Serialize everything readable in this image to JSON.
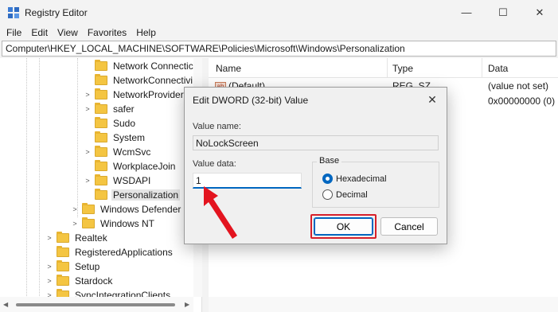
{
  "window": {
    "title": "Registry Editor",
    "minimize_glyph": "—",
    "maximize_glyph": "☐",
    "close_glyph": "✕"
  },
  "menu": [
    "File",
    "Edit",
    "View",
    "Favorites",
    "Help"
  ],
  "address": "Computer\\HKEY_LOCAL_MACHINE\\SOFTWARE\\Policies\\Microsoft\\Windows\\Personalization",
  "tree": [
    {
      "label": "Network Connectic",
      "chevron": ""
    },
    {
      "label": "NetworkConnectivi",
      "chevron": ""
    },
    {
      "label": "NetworkProvider",
      "chevron": ">"
    },
    {
      "label": "safer",
      "chevron": ">"
    },
    {
      "label": "Sudo",
      "chevron": ""
    },
    {
      "label": "System",
      "chevron": ""
    },
    {
      "label": "WcmSvc",
      "chevron": ">"
    },
    {
      "label": "WorkplaceJoin",
      "chevron": ""
    },
    {
      "label": "WSDAPI",
      "chevron": ">"
    },
    {
      "label": "Personalization",
      "chevron": ""
    },
    {
      "label": "Windows Defender",
      "chevron": ">"
    },
    {
      "label": "Windows NT",
      "chevron": ">"
    },
    {
      "label": "Realtek",
      "chevron": ">"
    },
    {
      "label": "RegisteredApplications",
      "chevron": ""
    },
    {
      "label": "Setup",
      "chevron": ">"
    },
    {
      "label": "Stardock",
      "chevron": ">"
    },
    {
      "label": "SyncIntegrationClients",
      "chevron": ">"
    }
  ],
  "list": {
    "columns": [
      "Name",
      "Type",
      "Data"
    ],
    "rows": [
      {
        "icon": "ab",
        "name": "(Default)",
        "type": "REG_SZ",
        "data": "(value not set)"
      },
      {
        "icon": "",
        "name": "",
        "type": "",
        "data": "0x00000000 (0)"
      }
    ]
  },
  "dialog": {
    "title": "Edit DWORD (32-bit) Value",
    "close_glyph": "✕",
    "value_name_label": "Value name:",
    "value_name": "NoLockScreen",
    "value_data_label": "Value data:",
    "value_data": "1",
    "base_label": "Base",
    "base_options": [
      "Hexadecimal",
      "Decimal"
    ],
    "base_selected": "Hexadecimal",
    "ok_label": "OK",
    "cancel_label": "Cancel"
  },
  "colors": {
    "accent": "#0067c0",
    "highlight": "#d6202a",
    "folder": "#f4c542"
  }
}
